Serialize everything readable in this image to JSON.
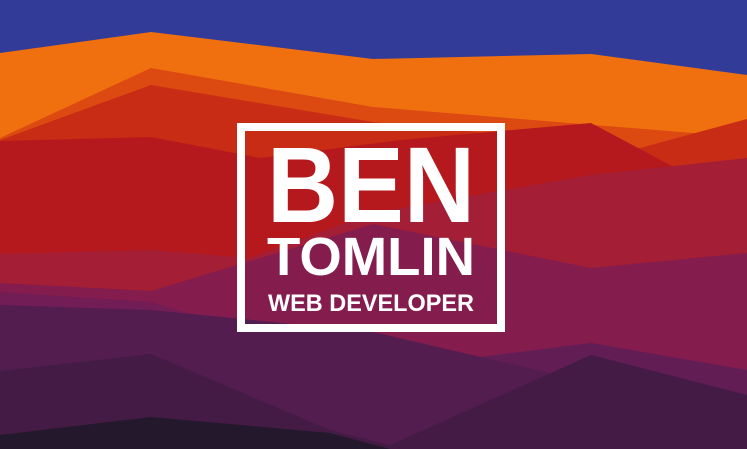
{
  "logo": {
    "first_name": "BEN",
    "last_name": "TOMLIN",
    "tagline": "WEB DEVELOPER"
  },
  "colors": {
    "sky": "#333b98",
    "orange": "#f07010",
    "dark_orange": "#dc4a12",
    "red_orange": "#c82c14",
    "red": "#b5191d",
    "crimson": "#a41e35",
    "magenta": "#841c4e",
    "plum": "#721d55",
    "purple": "#541d50",
    "purple_light": "#621d55",
    "deep_purple": "#431b45",
    "night": "#24182c",
    "logo_white": "#ffffff"
  }
}
